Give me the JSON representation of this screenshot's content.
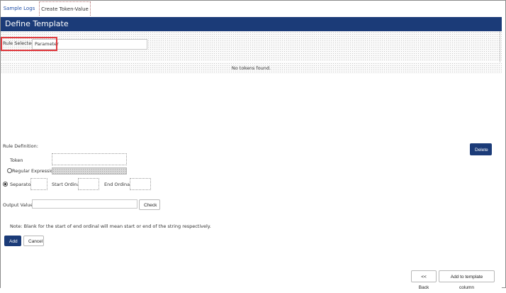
{
  "tabs": [
    {
      "label": "Sample Logs"
    },
    {
      "label": "Create Token-Value"
    }
  ],
  "header": {
    "title": "Define Template"
  },
  "rule_selected": {
    "label": "Rule Selected",
    "value": "Parameter"
  },
  "tokens": {
    "empty_text": "No tokens found."
  },
  "rule_definition": {
    "heading": "Rule Definition:",
    "token_label": "Token",
    "regex_label": "Regular Expression",
    "separator_label": "Separator",
    "start_ordinal_label": "Start Ordinal",
    "end_ordinal_label": "End Ordinal",
    "output_value_label": "Output Value",
    "check_label": "Check",
    "note": "Note: Blank for the start of end ordinal will mean start or end of the string respectively.",
    "selected_mode": "separator"
  },
  "buttons": {
    "delete": "Delete",
    "add": "Add",
    "cancel": "Cancel",
    "back": "<< Back",
    "add_to_template": "Add to template column"
  },
  "colors": {
    "accent": "#1b3b78",
    "highlight": "#e0393e"
  }
}
